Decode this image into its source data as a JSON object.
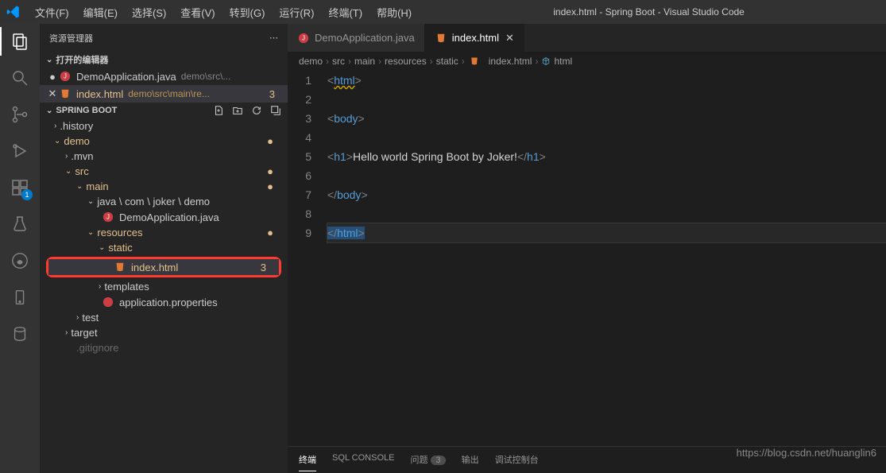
{
  "window": {
    "title": "index.html - Spring Boot - Visual Studio Code"
  },
  "menu": [
    "文件(F)",
    "编辑(E)",
    "选择(S)",
    "查看(V)",
    "转到(G)",
    "运行(R)",
    "终端(T)",
    "帮助(H)"
  ],
  "sidebar": {
    "title": "资源管理器",
    "openEditors": {
      "label": "打开的编辑器",
      "files": [
        {
          "name": "DemoApplication.java",
          "path": "demo\\src\\...",
          "icon": "java",
          "unsaved": true
        },
        {
          "name": "index.html",
          "path": "demo\\src\\main\\re...",
          "icon": "html",
          "count": "3",
          "active": true
        }
      ]
    },
    "project": {
      "name": "SPRING BOOT"
    },
    "tree": {
      "history": ".history",
      "demo": "demo",
      "mvn": ".mvn",
      "src": "src",
      "main": "main",
      "javaPath": "java \\ com \\ joker \\ demo",
      "demoApp": "DemoApplication.java",
      "resources": "resources",
      "static": "static",
      "indexHtml": "index.html",
      "indexHtmlCount": "3",
      "templates": "templates",
      "appProps": "application.properties",
      "test": "test",
      "target": "target",
      "gitignore": ".gitignore"
    }
  },
  "tabs": [
    {
      "name": "DemoApplication.java",
      "icon": "java"
    },
    {
      "name": "index.html",
      "icon": "html",
      "active": true
    }
  ],
  "breadcrumb": [
    "demo",
    "src",
    "main",
    "resources",
    "static",
    "index.html",
    "html"
  ],
  "code": {
    "lines": [
      "1",
      "2",
      "3",
      "4",
      "5",
      "6",
      "7",
      "8",
      "9"
    ],
    "l1a": "<",
    "l1b": "html",
    "l1c": ">",
    "l3a": "<",
    "l3b": "body",
    "l3c": ">",
    "l5a": "<",
    "l5b": "h1",
    "l5c": ">",
    "l5txt": "Hello world Spring Boot by Joker!",
    "l5d": "</",
    "l5e": "h1",
    "l5f": ">",
    "l7a": "</",
    "l7b": "body",
    "l7c": ">",
    "l9a": "</",
    "l9b": "html",
    "l9c": ">"
  },
  "bottomTabs": {
    "terminal": "终端",
    "sql": "SQL CONSOLE",
    "problems": "问题",
    "problemsCount": "3",
    "output": "输出",
    "debug": "调试控制台"
  },
  "watermark": "https://blog.csdn.net/huanglin6"
}
